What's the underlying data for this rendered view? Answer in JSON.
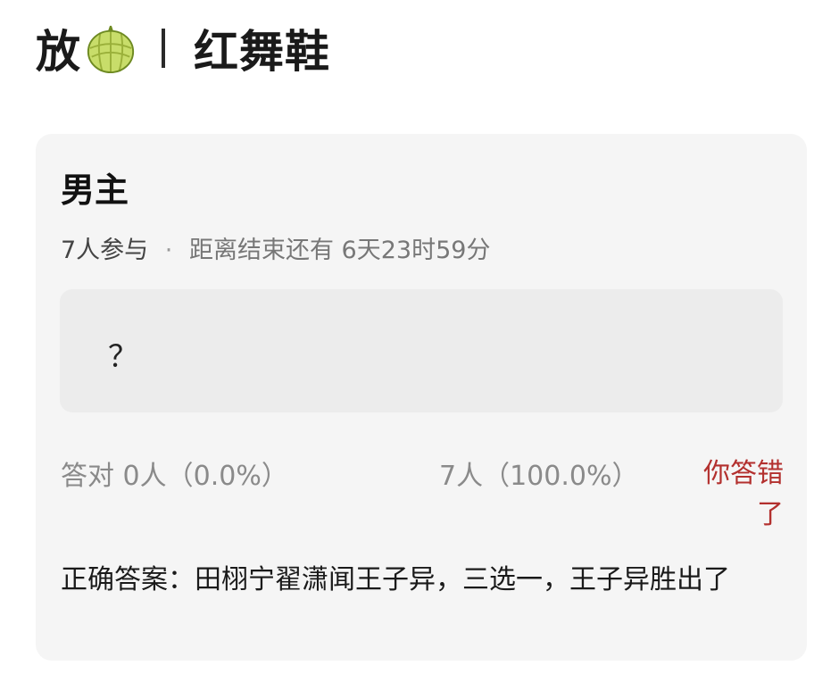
{
  "header": {
    "prefix": "放",
    "icon": "melon-icon",
    "topic": "红舞鞋"
  },
  "card": {
    "title": "男主",
    "participants": "7人参与",
    "separator": "·",
    "remaining": "距离结束还有 6天23时59分",
    "option_text": "？",
    "correct_label": "答对  0人（0.0%）",
    "wrong_count": "7人（100.0%）",
    "result": "你答错了",
    "answer": "正确答案：田栩宁翟潇闻王子异，三选一，王子异胜出了"
  },
  "colors": {
    "wrong": "#b3302e",
    "card_bg": "#f5f5f5",
    "option_bg": "#ececec"
  }
}
